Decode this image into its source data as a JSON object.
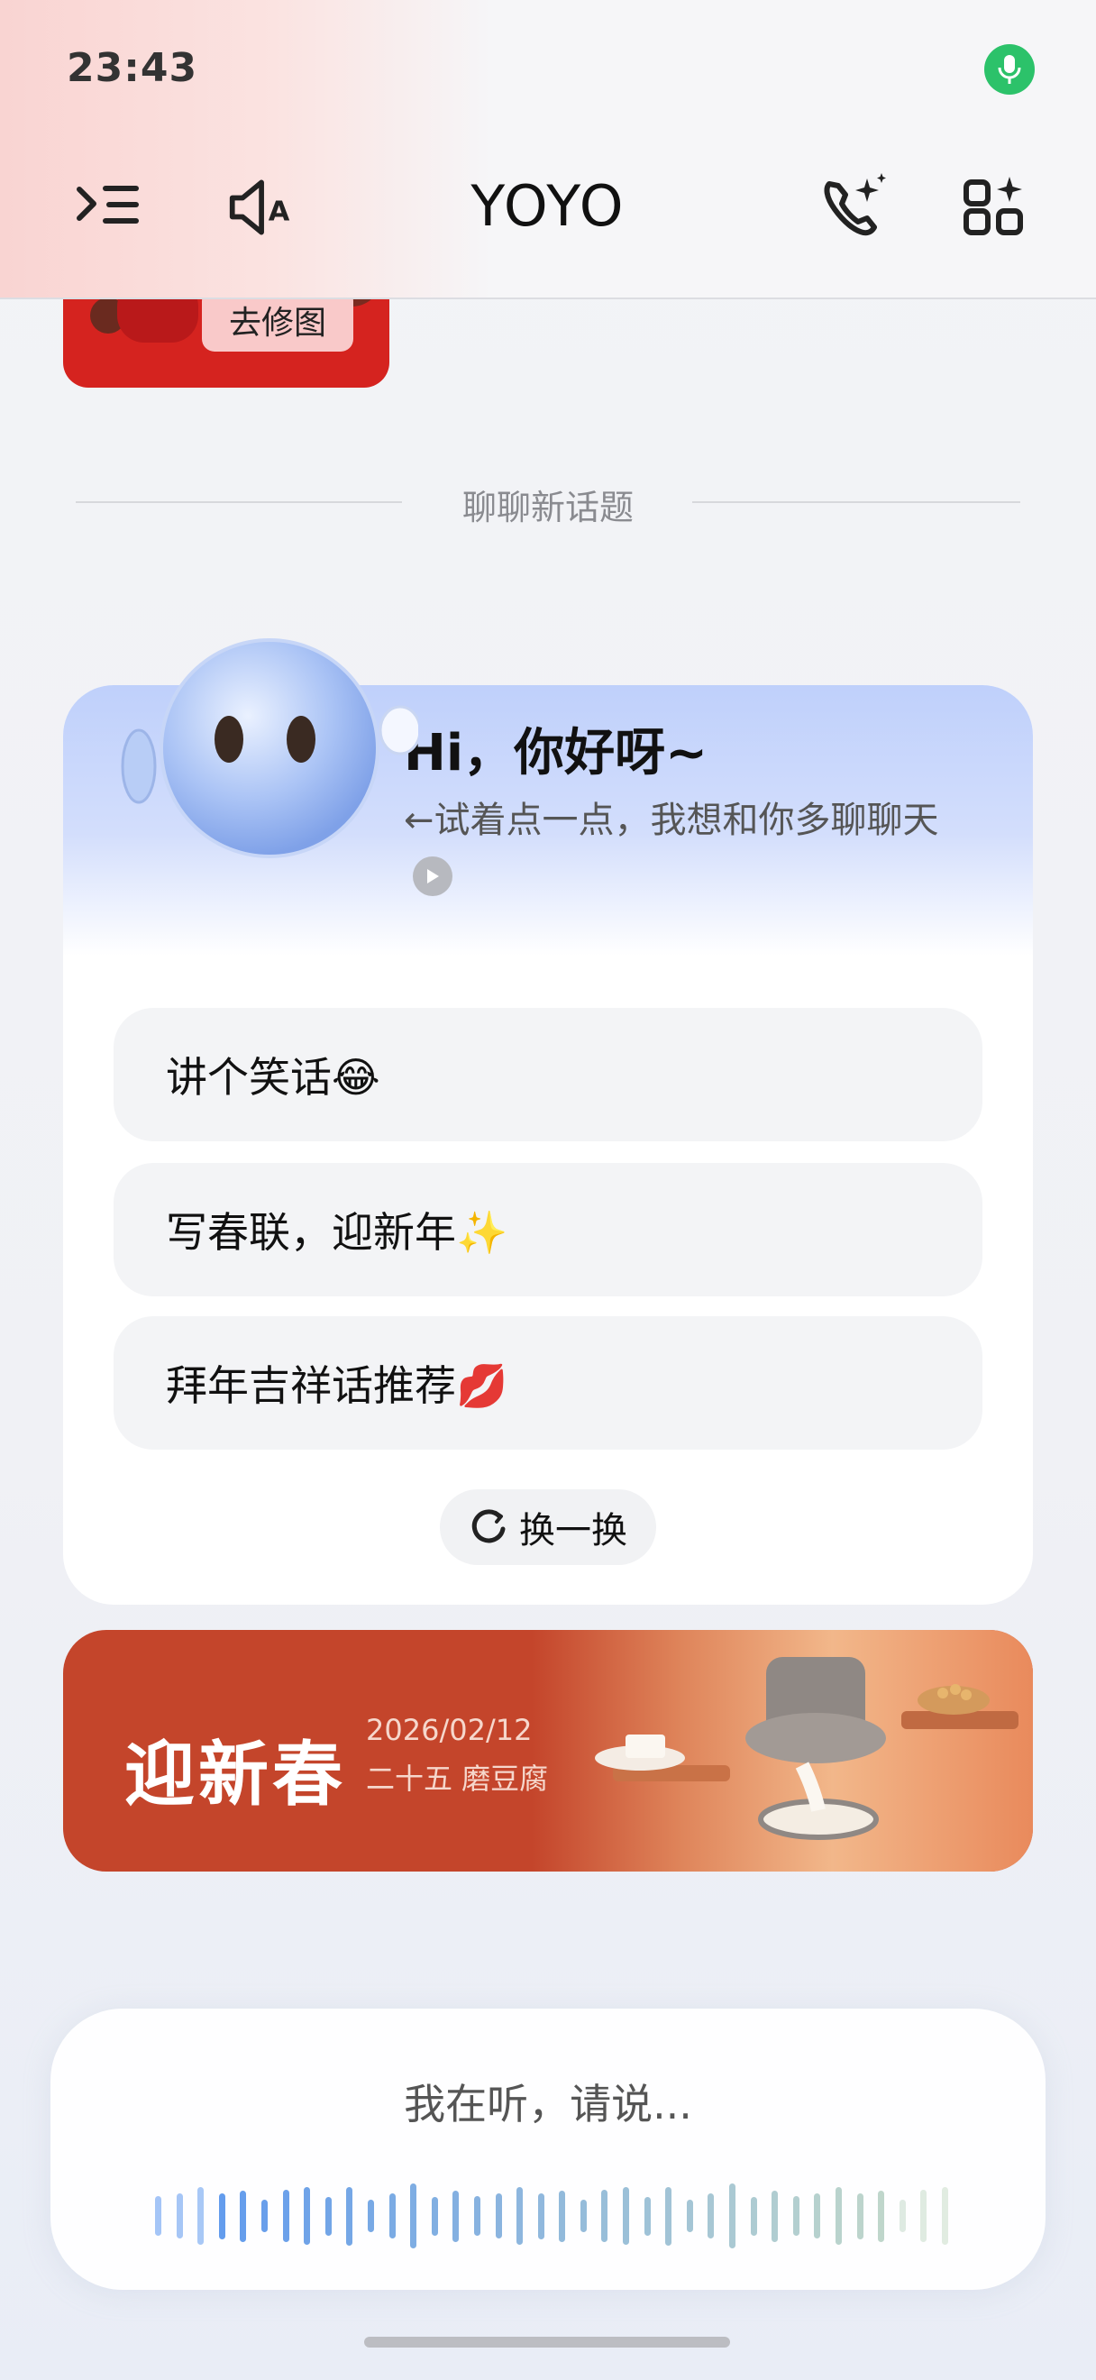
{
  "status_bar": {
    "time": "23:43"
  },
  "header": {
    "title": "YOYO",
    "icons": [
      "menu-icon",
      "speaker-a-icon",
      "ai-call-icon",
      "apps-icon"
    ]
  },
  "thumbnail": {
    "button_label": "去修图"
  },
  "divider": {
    "label": "聊聊新话题"
  },
  "greeting_card": {
    "greeting": "Hi，你好呀~",
    "hint": "←试着点一点，我想和你多聊聊天",
    "suggestions": [
      {
        "label": "讲个笑话😂"
      },
      {
        "label": "写春联，迎新年✨"
      },
      {
        "label": "拜年吉祥话推荐💋"
      }
    ],
    "refresh_label": "换一换"
  },
  "banner": {
    "title": "迎新春",
    "date": "2026/02/12",
    "subtitle": "二十五 磨豆腐"
  },
  "voice_panel": {
    "status_text": "我在听，请说..."
  },
  "colors": {
    "mic_green": "#2cc26a",
    "banner_red": "#c4452b",
    "card_gradient_top": "#bfd0fb"
  }
}
